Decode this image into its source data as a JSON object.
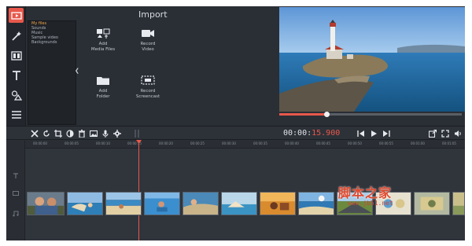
{
  "import_panel": {
    "title": "Import",
    "categories": [
      {
        "label": "My files",
        "selected": true
      },
      {
        "label": "Sounds",
        "selected": false
      },
      {
        "label": "Music",
        "selected": false
      },
      {
        "label": "Sample video",
        "selected": false
      },
      {
        "label": "Backgrounds",
        "selected": false
      }
    ],
    "tiles": {
      "add_media": "Add\nMedia Files",
      "record_video": "Record\nVideo",
      "add_folder": "Add\nFolder",
      "record_screencast": "Record\nScreencast"
    }
  },
  "left_rail": {
    "icons": [
      "import-icon",
      "magic-wand-icon",
      "filters-icon",
      "titles-icon",
      "shapes-icon",
      "more-icon"
    ]
  },
  "player": {
    "timecode_main": "00:00:",
    "timecode_frac": "15.900",
    "progress": 0.26
  },
  "toolbar": {
    "icons": [
      "cut-icon",
      "rotate-icon",
      "crop-icon",
      "color-icon",
      "delete-icon",
      "image-icon",
      "audio-icon",
      "settings-icon"
    ]
  },
  "timeline": {
    "ticks": [
      "00:00:00",
      "00:00:05",
      "00:00:10",
      "00:00:15",
      "00:00:20",
      "00:00:25",
      "00:00:30",
      "00:00:35",
      "00:00:40",
      "00:00:45",
      "00:00:50",
      "00:00:55",
      "00:01:00",
      "00:01:05"
    ]
  },
  "watermark": {
    "logo": "脚本之家",
    "url": "www.jb51.net"
  },
  "colors": {
    "accent": "#e8584b",
    "panel": "#2a2e35",
    "selected_category": "#f0a54a"
  }
}
